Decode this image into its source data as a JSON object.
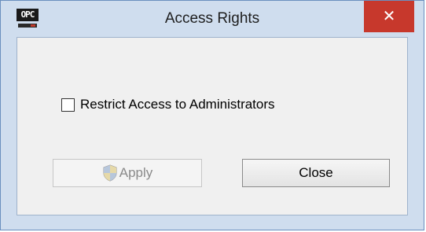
{
  "window": {
    "title": "Access Rights",
    "app_icon_text": "OPC",
    "close_glyph": "✕"
  },
  "options": {
    "restrict_label": "Restrict Access to Administrators",
    "restrict_checked": false
  },
  "buttons": {
    "apply_label": "Apply",
    "apply_enabled": false,
    "close_label": "Close"
  },
  "icons": {
    "app": "opc-logo-icon",
    "apply": "uac-shield-icon"
  }
}
